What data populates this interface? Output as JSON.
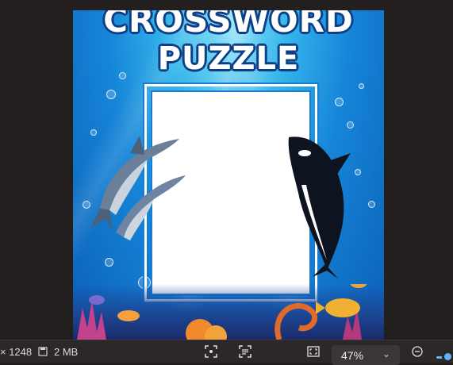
{
  "poster": {
    "title_line1": "CROSSWORD",
    "title_line2": "PUZZLE"
  },
  "status": {
    "dimensions": "× 1248",
    "size": "2 MB",
    "zoom": "47%"
  },
  "icons": {
    "save": "save-icon",
    "focus": "focus-icon",
    "text_select": "text-select-icon",
    "fit": "fit-to-window-icon",
    "zoom_out": "zoom-out-icon"
  },
  "colors": {
    "background": "#221f1e",
    "ocean": "#1685d8",
    "title_outline": "#0e3f86",
    "accent": "#5fb3ff"
  }
}
